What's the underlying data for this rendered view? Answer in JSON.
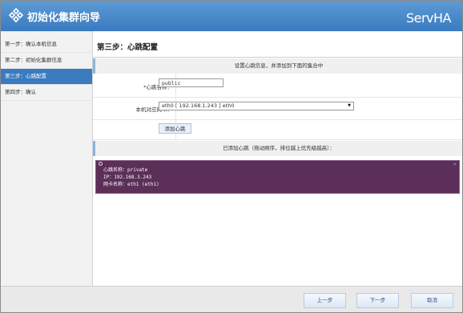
{
  "window": {
    "title": "初始化集群向导",
    "brand": "ServHA"
  },
  "sidebar": {
    "steps": [
      {
        "label": "第一步：确认本机信息"
      },
      {
        "label": "第二步：初始化集群信息"
      },
      {
        "label": "第三步：心跳配置",
        "active": true
      },
      {
        "label": "第四步：确认"
      }
    ]
  },
  "main": {
    "title": "第三步：心跳配置",
    "instruction": "设置心跳信息，并添加到下面的集合中",
    "form": {
      "name_label": "*心跳名称：",
      "name_value": "public",
      "nic_label": "本机对应网卡：",
      "nic_value": "eth0 [ 192.168.1.243 ] eth0",
      "add_button": "添加心跳"
    },
    "added_header": "已添加心跳（拖动顺序，排位越上优先级越高）：",
    "heartbeats": [
      {
        "name_line": "心跳名称：private",
        "ip_line": "IP：192.168.3.243",
        "nic_line": "网卡名称：eth1 (eth1)"
      }
    ]
  },
  "footer": {
    "prev_button": "上一步",
    "next_button": "下一步",
    "cancel_button": "取消"
  },
  "colors": {
    "accent": "#3a7bc0",
    "card": "#5b2f57"
  }
}
